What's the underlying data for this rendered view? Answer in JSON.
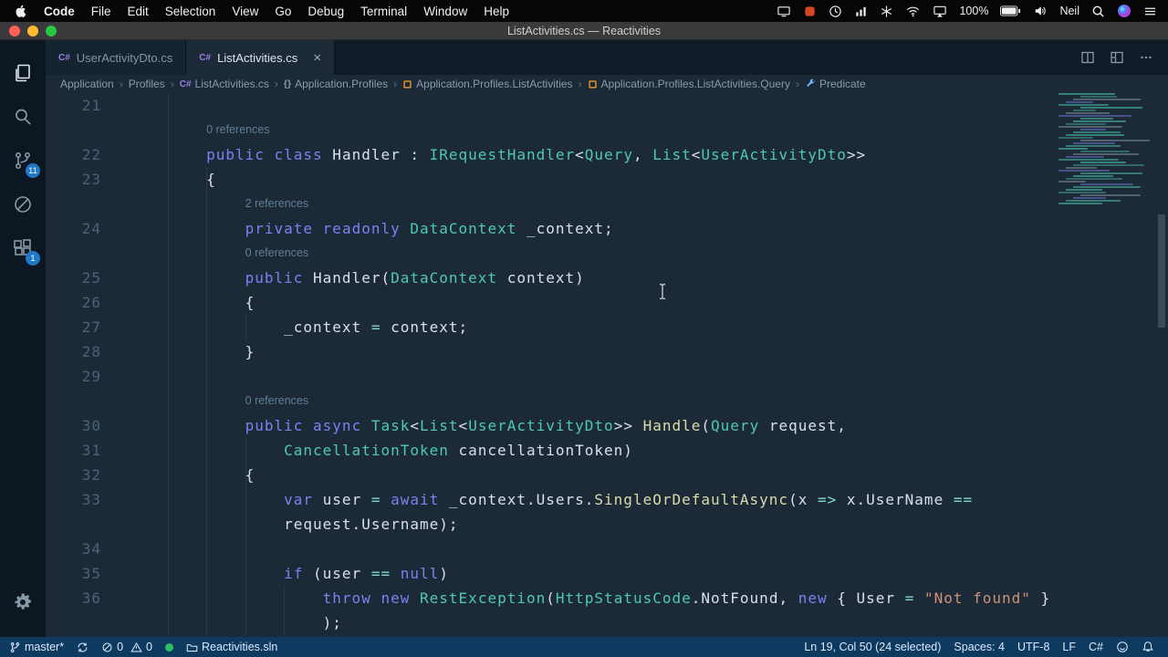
{
  "window": {
    "title": "ListActivities.cs — Reactivities"
  },
  "menubar": {
    "items": [
      "Code",
      "File",
      "Edit",
      "Selection",
      "View",
      "Go",
      "Debug",
      "Terminal",
      "Window",
      "Help"
    ],
    "status_icons_before": [
      "display-icon",
      "record-icon",
      "clock-icon",
      "levels-icon",
      "snowflake-icon",
      "wifi-icon",
      "airplay-icon"
    ],
    "battery": "100%",
    "status_icons_mid": [
      "battery-icon",
      "volume-icon"
    ],
    "user": "Neil",
    "status_icons_after": [
      "spotlight-icon",
      "siri-icon",
      "menu-lines-icon"
    ]
  },
  "activitybar": {
    "items": [
      "explorer",
      "search",
      "source-control",
      "debug",
      "extensions"
    ],
    "scm_badge": "11",
    "ext_badge": "1"
  },
  "tabs": [
    {
      "label": "UserActivityDto.cs",
      "active": false
    },
    {
      "label": "ListActivities.cs",
      "active": true
    }
  ],
  "breadcrumbs": [
    {
      "label": "Application",
      "icon": ""
    },
    {
      "label": "Profiles",
      "icon": ""
    },
    {
      "label": "ListActivities.cs",
      "icon": "csharp-file-icon"
    },
    {
      "label": "Application.Profiles",
      "icon": "namespace-icon"
    },
    {
      "label": "Application.Profiles.ListActivities",
      "icon": "class-icon"
    },
    {
      "label": "Application.Profiles.ListActivities.Query",
      "icon": "class-icon"
    },
    {
      "label": "Predicate",
      "icon": "property-icon"
    }
  ],
  "icons": {
    "close_tab": "×",
    "breadcrumb_sep": "›",
    "cs_label": "C#",
    "namespace_glyph": "{}"
  },
  "editor": {
    "lines": [
      {
        "t": "code",
        "n": "21",
        "tk": []
      },
      {
        "t": "lens",
        "indent": 8,
        "text": "0 references"
      },
      {
        "t": "code",
        "n": "22",
        "tk": [
          [
            "        ",
            ""
          ],
          [
            "public",
            "kw"
          ],
          [
            " ",
            ""
          ],
          [
            "class",
            "kw"
          ],
          [
            " Handler : ",
            ""
          ],
          [
            "IRequestHandler",
            "ty"
          ],
          [
            "<",
            ""
          ],
          [
            "Query",
            "ty"
          ],
          [
            ", ",
            ""
          ],
          [
            "List",
            "ty"
          ],
          [
            "<",
            ""
          ],
          [
            "UserActivityDto",
            "ty"
          ],
          [
            ">>",
            ""
          ]
        ]
      },
      {
        "t": "code",
        "n": "23",
        "tk": [
          [
            "        {",
            ""
          ]
        ]
      },
      {
        "t": "lens",
        "indent": 12,
        "text": "2 references"
      },
      {
        "t": "code",
        "n": "24",
        "tk": [
          [
            "            ",
            ""
          ],
          [
            "private",
            "kw"
          ],
          [
            " ",
            ""
          ],
          [
            "readonly",
            "kw"
          ],
          [
            " ",
            ""
          ],
          [
            "DataContext",
            "ty"
          ],
          [
            " _context;",
            ""
          ]
        ]
      },
      {
        "t": "lens",
        "indent": 12,
        "text": "0 references"
      },
      {
        "t": "code",
        "n": "25",
        "tk": [
          [
            "            ",
            ""
          ],
          [
            "public",
            "kw"
          ],
          [
            " Handler(",
            ""
          ],
          [
            "DataContext",
            "ty"
          ],
          [
            " context)",
            ""
          ]
        ]
      },
      {
        "t": "code",
        "n": "26",
        "tk": [
          [
            "            {",
            ""
          ]
        ]
      },
      {
        "t": "code",
        "n": "27",
        "tk": [
          [
            "                _context ",
            ""
          ],
          [
            "=",
            "op"
          ],
          [
            " context;",
            ""
          ]
        ]
      },
      {
        "t": "code",
        "n": "28",
        "tk": [
          [
            "            }",
            ""
          ]
        ]
      },
      {
        "t": "code",
        "n": "29",
        "tk": []
      },
      {
        "t": "lens",
        "indent": 12,
        "text": "0 references"
      },
      {
        "t": "code",
        "n": "30",
        "tk": [
          [
            "            ",
            ""
          ],
          [
            "public",
            "kw"
          ],
          [
            " ",
            ""
          ],
          [
            "async",
            "kw"
          ],
          [
            " ",
            ""
          ],
          [
            "Task",
            "ty"
          ],
          [
            "<",
            ""
          ],
          [
            "List",
            "ty"
          ],
          [
            "<",
            ""
          ],
          [
            "UserActivityDto",
            "ty"
          ],
          [
            ">> ",
            ""
          ],
          [
            "Handle",
            "me"
          ],
          [
            "(",
            ""
          ],
          [
            "Query",
            "ty"
          ],
          [
            " request,",
            ""
          ]
        ]
      },
      {
        "t": "code",
        "n": "31",
        "tk": [
          [
            "                ",
            ""
          ],
          [
            "CancellationToken",
            "ty"
          ],
          [
            " cancellationToken)",
            ""
          ]
        ]
      },
      {
        "t": "code",
        "n": "32",
        "tk": [
          [
            "            {",
            ""
          ]
        ]
      },
      {
        "t": "code",
        "n": "33",
        "tk": [
          [
            "                ",
            ""
          ],
          [
            "var",
            "kw"
          ],
          [
            " user ",
            ""
          ],
          [
            "=",
            "op"
          ],
          [
            " ",
            ""
          ],
          [
            "await",
            "kw"
          ],
          [
            " _context.Users.",
            ""
          ],
          [
            "SingleOrDefaultAsync",
            "me"
          ],
          [
            "(x ",
            ""
          ],
          [
            "=>",
            "op"
          ],
          [
            " x.UserName ",
            ""
          ],
          [
            "==",
            "op"
          ]
        ]
      },
      {
        "t": "code",
        "n": "",
        "tk": [
          [
            "                request.Username);",
            ""
          ]
        ]
      },
      {
        "t": "code",
        "n": "34",
        "tk": []
      },
      {
        "t": "code",
        "n": "35",
        "tk": [
          [
            "                ",
            ""
          ],
          [
            "if",
            "kw"
          ],
          [
            " (user ",
            ""
          ],
          [
            "==",
            "op"
          ],
          [
            " ",
            ""
          ],
          [
            "null",
            "kw"
          ],
          [
            ")",
            ""
          ]
        ]
      },
      {
        "t": "code",
        "n": "36",
        "tk": [
          [
            "                    ",
            ""
          ],
          [
            "throw",
            "kw"
          ],
          [
            " ",
            ""
          ],
          [
            "new",
            "kw"
          ],
          [
            " ",
            ""
          ],
          [
            "RestException",
            "ty"
          ],
          [
            "(",
            ""
          ],
          [
            "HttpStatusCode",
            "ty"
          ],
          [
            ".NotFound, ",
            ""
          ],
          [
            "new",
            "kw"
          ],
          [
            " { User ",
            ""
          ],
          [
            "=",
            "op"
          ],
          [
            " ",
            ""
          ],
          [
            "\"Not found\"",
            "st"
          ],
          [
            " }",
            ""
          ]
        ]
      },
      {
        "t": "code",
        "n": "",
        "tk": [
          [
            "                    );",
            ""
          ]
        ]
      }
    ]
  },
  "statusbar": {
    "branch": "master*",
    "errors": "0",
    "warnings": "0",
    "project": "Reactivities.sln",
    "cursor": "Ln 19, Col 50 (24 selected)",
    "indent": "Spaces: 4",
    "encoding": "UTF-8",
    "eol": "LF",
    "language": "C#"
  },
  "theme": {
    "menubar-bg": "#060607",
    "titlebar-bg": "#3a3a3c",
    "editor-bg": "#1c2a38",
    "tabstrip-bg": "#0f1b26",
    "tab-inactive-bg": "#152431",
    "activity-bg": "#0d1722",
    "statusbar-bg": "#0e3a5f",
    "badge-bg": "#1f78c8",
    "gutter-fg": "#4a637c",
    "lens-fg": "#5f7e97",
    "tx": "#d6e0ea",
    "kw": "#7a82f0",
    "ty": "#4ec9b0",
    "me": "#dcdcaa",
    "op": "#7fdbca",
    "st": "#ce9178"
  }
}
